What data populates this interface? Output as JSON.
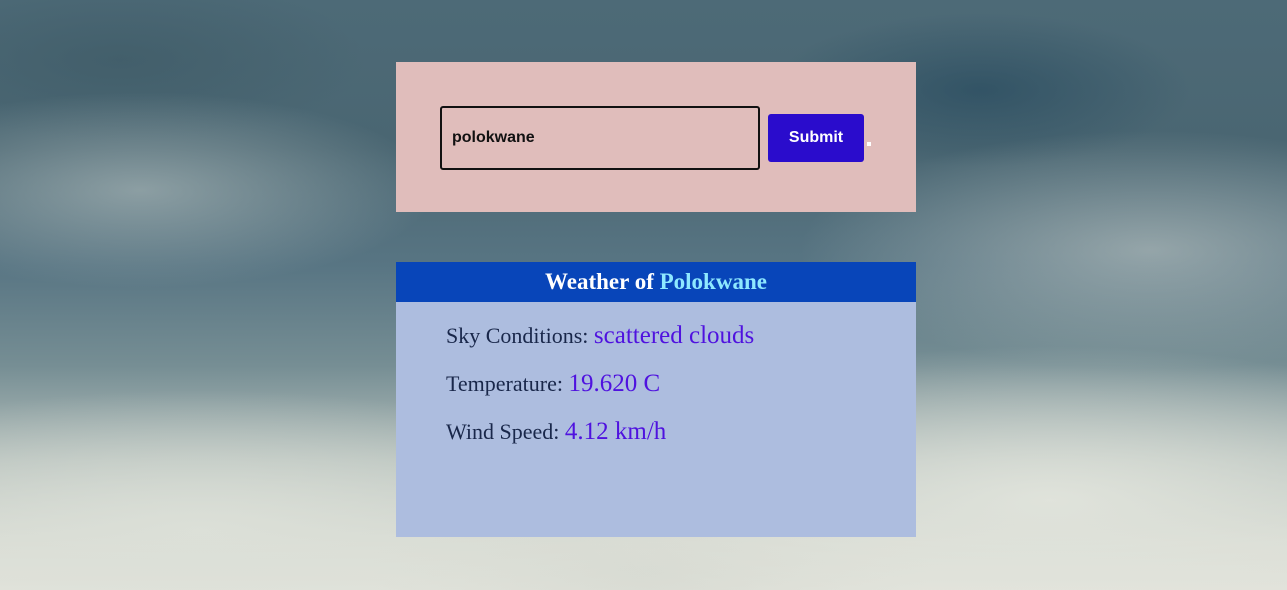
{
  "search": {
    "input_value": "polokwane",
    "submit_label": "Submit",
    "trailing_mark": "."
  },
  "weather": {
    "title_prefix": "Weather of",
    "city": "Polokwane",
    "rows": [
      {
        "label": "Sky Conditions:",
        "value": "scattered clouds"
      },
      {
        "label": "Temperature:",
        "value": "19.620 C"
      },
      {
        "label": "Wind Speed:",
        "value": "4.12 km/h"
      }
    ]
  },
  "colors": {
    "search_panel_bg": "#e0bdbb",
    "submit_button_bg": "#2a0ccc",
    "weather_header_bg": "#0845b9",
    "weather_panel_bg": "#adbddf",
    "city_name_color": "#8ee8ff",
    "value_color": "#4f12df",
    "label_color": "#19274a"
  }
}
